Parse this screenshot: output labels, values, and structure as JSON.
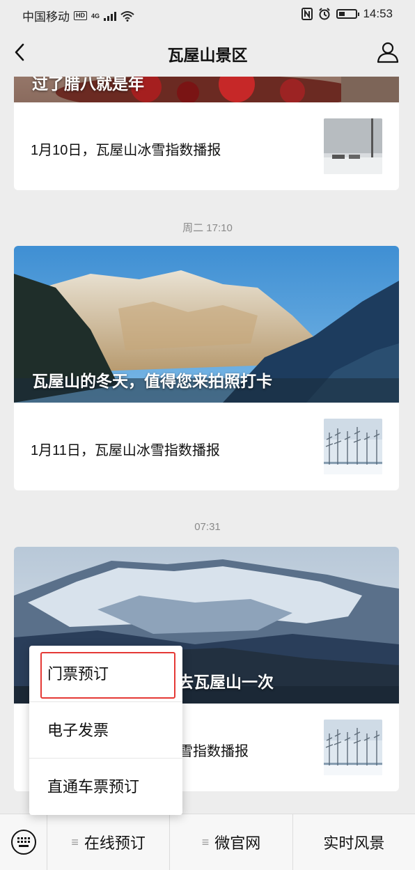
{
  "status_bar": {
    "carrier": "中国移动",
    "hd": "HD",
    "network": "4G",
    "time": "14:53",
    "battery_level": 0.35
  },
  "nav": {
    "title": "瓦屋山景区"
  },
  "feed": [
    {
      "cover_caption": "过了腊八就是年",
      "headline": "1月10日，瓦屋山冰雪指数播报"
    },
    {
      "timestamp": "周二 17:10",
      "cover_caption": "瓦屋山的冬天，值得您来拍照打卡",
      "headline": "1月11日，瓦屋山冰雪指数播报"
    },
    {
      "timestamp": "07:31",
      "cover_caption": "去瓦屋山一次",
      "headline": "雪指数播报"
    }
  ],
  "popup_menu": {
    "items": [
      "门票预订",
      "电子发票",
      "直通车票预订"
    ]
  },
  "bottom_menu": {
    "items": [
      "在线预订",
      "微官网",
      "实时风景"
    ]
  },
  "colors": {
    "highlight": "#e53935",
    "background": "#ededed"
  }
}
